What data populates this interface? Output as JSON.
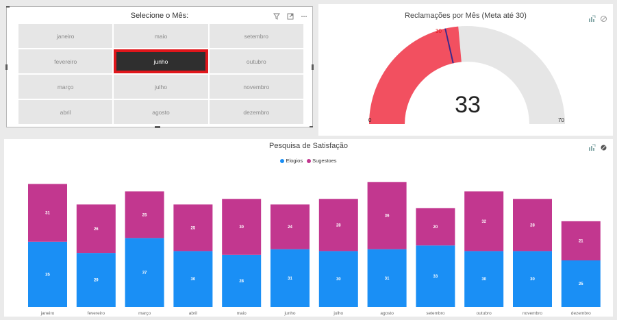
{
  "slicer": {
    "title": "Selecione o Mês:",
    "selected": "junho",
    "months": [
      "janeiro",
      "maio",
      "setembro",
      "fevereiro",
      "junho",
      "outubro",
      "março",
      "julho",
      "novembro",
      "abril",
      "agosto",
      "dezembro"
    ]
  },
  "gauge": {
    "title": "Reclamações por Mês (Meta até 30)",
    "value": 33,
    "min": 0,
    "max": 70,
    "target": 30,
    "fill_color": "#f25060",
    "track_color": "#e6e6e6",
    "target_color": "#3b2a8c"
  },
  "chart": {
    "title": "Pesquisa de Satisfação",
    "legend": [
      "Elogios",
      "Sugestoes"
    ]
  },
  "colors": {
    "accent": "#e0161b",
    "elogios": "#1a8ff5",
    "sugestoes": "#c2378f"
  },
  "chart_data": {
    "type": "bar",
    "stacked": true,
    "title": "Pesquisa de Satisfação",
    "categories": [
      "janeiro",
      "fevereiro",
      "março",
      "abril",
      "maio",
      "junho",
      "julho",
      "agosto",
      "setembro",
      "outubro",
      "novembro",
      "dezembro"
    ],
    "series": [
      {
        "name": "Elogios",
        "values": [
          35,
          29,
          37,
          30,
          28,
          31,
          30,
          31,
          33,
          30,
          30,
          25
        ]
      },
      {
        "name": "Sugestoes",
        "values": [
          31,
          26,
          25,
          25,
          30,
          24,
          28,
          36,
          20,
          32,
          28,
          21
        ]
      }
    ],
    "legend_position": "top-center",
    "grid": false
  }
}
